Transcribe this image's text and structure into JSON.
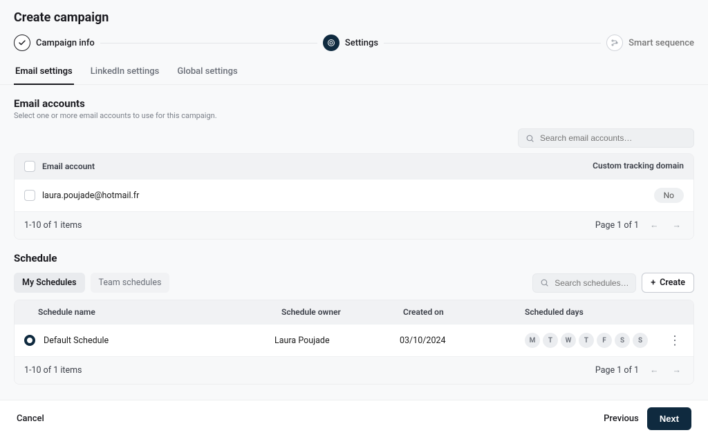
{
  "page_title": "Create campaign",
  "stepper": {
    "step1": "Campaign info",
    "step2": "Settings",
    "step3": "Smart sequence"
  },
  "tabs": {
    "email": "Email settings",
    "linkedin": "LinkedIn settings",
    "global": "Global settings"
  },
  "email_accounts": {
    "title": "Email accounts",
    "subtext": "Select one or more email accounts to use for this campaign.",
    "search_placeholder": "Search email accounts…",
    "col_account": "Email account",
    "col_domain": "Custom tracking domain",
    "row_email": "laura.poujade@hotmail.fr",
    "row_domain": "No",
    "count_label": "1-10 of 1 items",
    "page_label": "Page  1  of 1"
  },
  "schedule": {
    "title": "Schedule",
    "tab_my": "My Schedules",
    "tab_team": "Team schedules",
    "search_placeholder": "Search schedules…",
    "create_label": "Create",
    "col_name": "Schedule name",
    "col_owner": "Schedule owner",
    "col_created": "Created on",
    "col_days": "Scheduled days",
    "row_name": "Default Schedule",
    "row_owner": "Laura Poujade",
    "row_date": "03/10/2024",
    "days": [
      "M",
      "T",
      "W",
      "T",
      "F",
      "S",
      "S"
    ],
    "count_label": "1-10 of 1 items",
    "page_label": "Page  1  of 1"
  },
  "footer": {
    "cancel": "Cancel",
    "previous": "Previous",
    "next": "Next"
  }
}
